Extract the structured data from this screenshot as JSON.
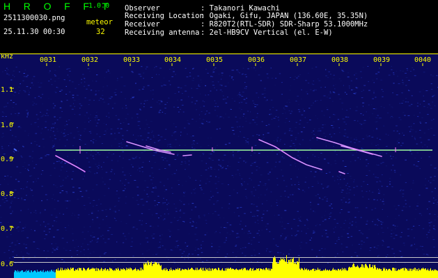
{
  "app": {
    "title": "H R O F F T",
    "version": "1.0.0",
    "filename": "2511300030.png",
    "datetime": "25.11.30 00:30",
    "meteor_label": "meteor",
    "meteor_count": "32"
  },
  "info": {
    "observer_label": "Observer",
    "observer_value": ": Takanori Kawachi",
    "location_label": "Receiving Location",
    "location_value": ": Ogaki, Gifu, JAPAN (136.60E, 35.35N)",
    "receiver_label": "Receiver",
    "receiver_value": ": R820T2(RTL-SDR) SDR-Sharp 53.1000MHz",
    "antenna_label": "Receiving antenna",
    "antenna_value": ": 2el-HB9CV Vertical (el. E-W)"
  },
  "spectrogram": {
    "y_unit": "kHz",
    "y_ticks": [
      "1.1",
      "1.0",
      "0.9",
      "0.8",
      "0.7",
      "0.6"
    ],
    "x_ticks": [
      "0031",
      "0032",
      "0033",
      "0034",
      "0035",
      "0036",
      "0037",
      "0038",
      "0039",
      "0040"
    ],
    "colors": {
      "background": "#0a0a5a",
      "noise": "#1a2aa0",
      "carrier": "#a0ffa0",
      "meteor_trail": "#ff60ff",
      "axis_text": "#ffff00",
      "level_bar": "#ffff00",
      "level_bar_cyan": "#00c8ff"
    }
  }
}
